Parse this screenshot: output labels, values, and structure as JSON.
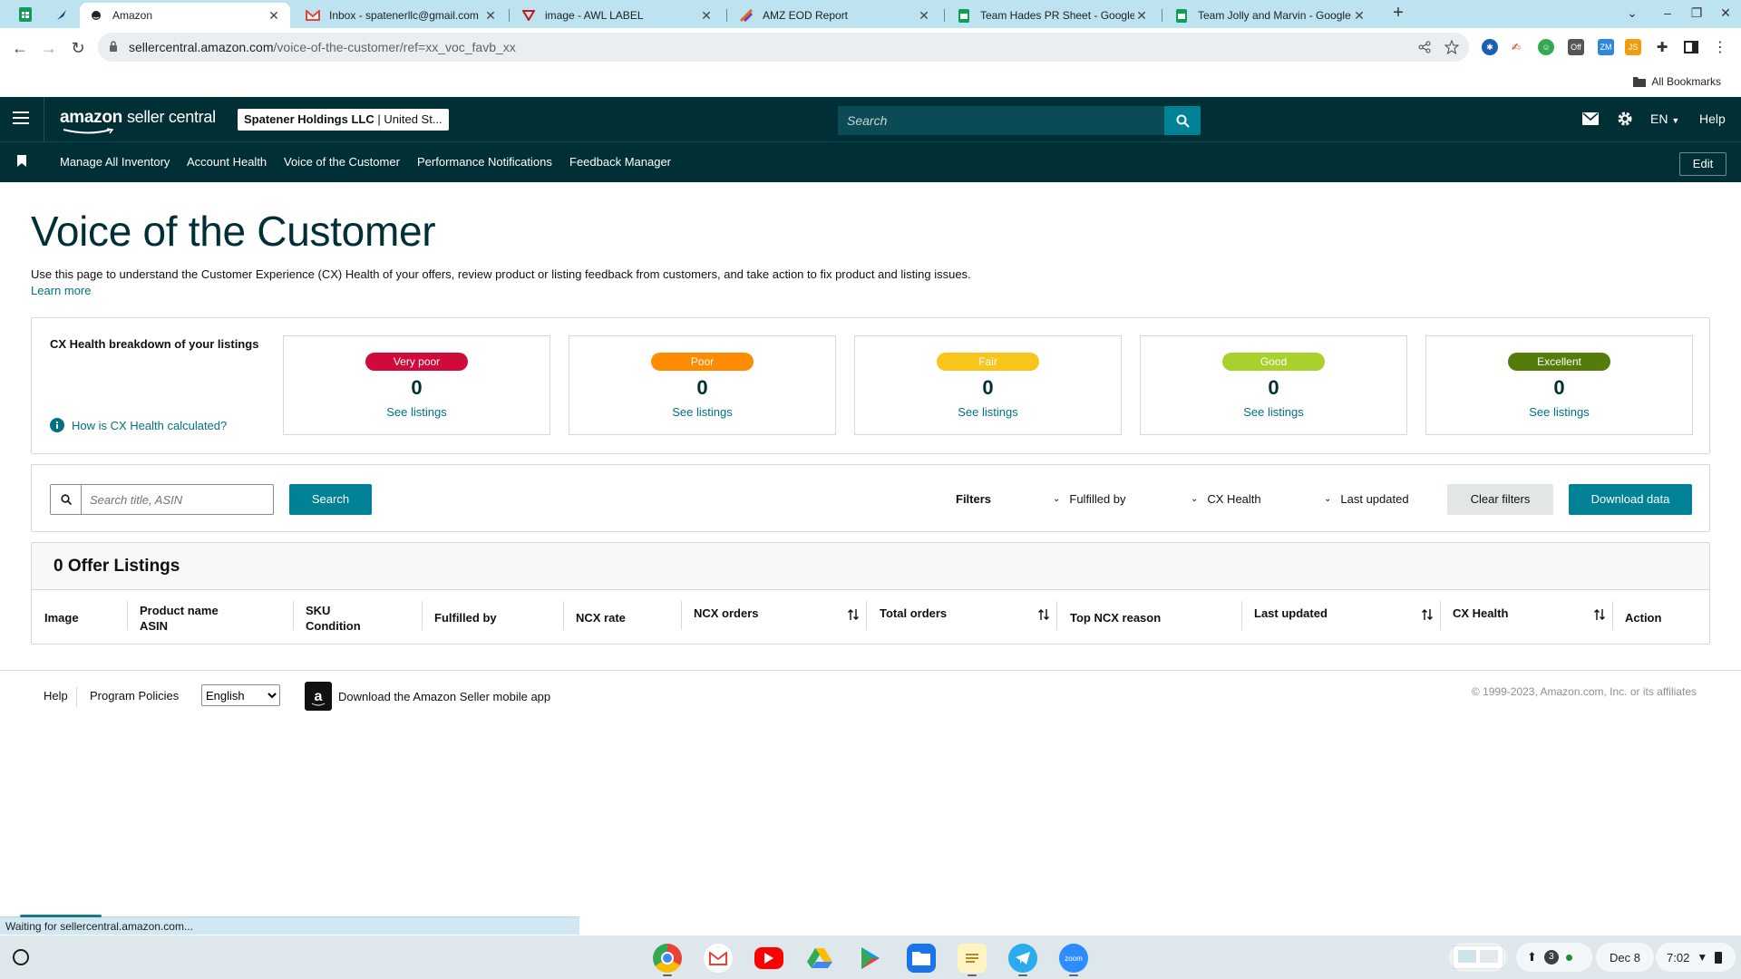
{
  "browser": {
    "tabs": [
      {
        "title": "Amazon",
        "active": true
      },
      {
        "title": "Inbox - spatenerllc@gmail.com"
      },
      {
        "title": "image - AWL LABEL"
      },
      {
        "title": "AMZ EOD Report"
      },
      {
        "title": "Team Hades PR Sheet - Google"
      },
      {
        "title": "Team Jolly and Marvin - Google"
      }
    ],
    "url_host": "sellercentral.amazon.com",
    "url_path": "/voice-of-the-customer/ref=xx_voc_favb_xx",
    "bookmarks_label": "All Bookmarks",
    "status_text": "Waiting for sellercentral.amazon.com..."
  },
  "header": {
    "logo_amazon": "amazon",
    "logo_sc": "seller central",
    "account_name": "Spatener Holdings LLC",
    "account_region": "United St...",
    "search_placeholder": "Search",
    "lang": "EN",
    "help": "Help"
  },
  "nav": {
    "items": [
      "Manage All Inventory",
      "Account Health",
      "Voice of the Customer",
      "Performance Notifications",
      "Feedback Manager"
    ],
    "edit": "Edit"
  },
  "page": {
    "title": "Voice of the Customer",
    "intro": "Use this page to understand the Customer Experience (CX) Health of your offers, review product or listing feedback from customers, and take action to fix product and listing issues.",
    "learn_more": "Learn more"
  },
  "cx": {
    "title": "CX Health breakdown of your listings",
    "how_link": "How is CX Health calculated?",
    "see_label": "See listings",
    "buckets": [
      {
        "label": "Very poor",
        "count": "0",
        "color": "#d00a3a"
      },
      {
        "label": "Poor",
        "count": "0",
        "color": "#ff8c00"
      },
      {
        "label": "Fair",
        "count": "0",
        "color": "#f8c51c"
      },
      {
        "label": "Good",
        "count": "0",
        "color": "#a9d12e"
      },
      {
        "label": "Excellent",
        "count": "0",
        "color": "#557b0a"
      }
    ]
  },
  "filters": {
    "search_placeholder": "Search title, ASIN",
    "search_button": "Search",
    "label": "Filters",
    "fulfilled_by": "Fulfilled by",
    "cx_health": "CX Health",
    "last_updated": "Last updated",
    "clear": "Clear filters",
    "download": "Download data"
  },
  "listings": {
    "title": "0 Offer Listings",
    "columns": {
      "image": "Image",
      "product": "Product name",
      "asin": "ASIN",
      "sku": "SKU",
      "condition": "Condition",
      "fulfilled": "Fulfilled by",
      "ncx_rate": "NCX rate",
      "ncx_orders": "NCX orders",
      "total_orders": "Total orders",
      "top_reason": "Top NCX reason",
      "last_updated": "Last updated",
      "cx_health": "CX Health",
      "action": "Action"
    }
  },
  "footer": {
    "help": "Help",
    "policies": "Program Policies",
    "language": "English",
    "app": "Download the Amazon Seller mobile app",
    "copyright": "© 1999-2023, Amazon.com, Inc. or its affiliates"
  },
  "shelf": {
    "notifications": "3",
    "date": "Dec 8",
    "time": "7:02"
  }
}
